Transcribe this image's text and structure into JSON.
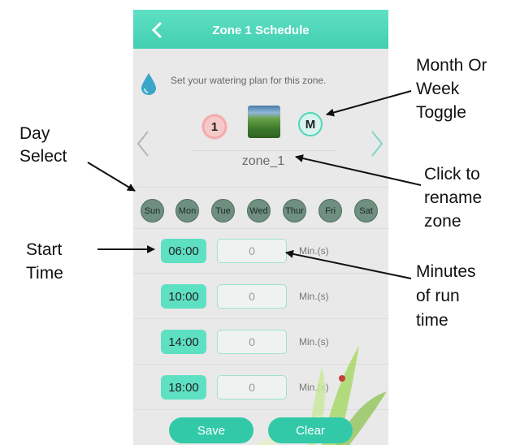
{
  "app": {
    "title": "Zone 1  Schedule",
    "intro": "Set your watering plan for this zone.",
    "day_count": "1",
    "mode": "M",
    "zone_name": "zone_1"
  },
  "days": [
    "Sun",
    "Mon",
    "Tue",
    "Wed",
    "Thur",
    "Fri",
    "Sat"
  ],
  "schedule": [
    {
      "time": "06:00",
      "minutes": "0",
      "unit": "Min.(s)"
    },
    {
      "time": "10:00",
      "minutes": "0",
      "unit": "Min.(s)"
    },
    {
      "time": "14:00",
      "minutes": "0",
      "unit": "Min.(s)"
    },
    {
      "time": "18:00",
      "minutes": "0",
      "unit": "Min.(s)"
    }
  ],
  "buttons": {
    "save": "Save",
    "clear": "Clear"
  },
  "annotations": {
    "month_week_1": "Month Or",
    "month_week_2": "Week",
    "month_week_3": "Toggle",
    "day_select_1": "Day",
    "day_select_2": "Select",
    "rename_1": "Click to",
    "rename_2": "rename",
    "rename_3": "zone",
    "start_time_1": "Start",
    "start_time_2": "Time",
    "minutes_1": "Minutes",
    "minutes_2": "of run",
    "minutes_3": "time"
  },
  "colors": {
    "accent": "#42cfb0",
    "button": "#32c9a8",
    "time_chip": "#5ee0c3",
    "day_chip": "#6f8f80"
  }
}
